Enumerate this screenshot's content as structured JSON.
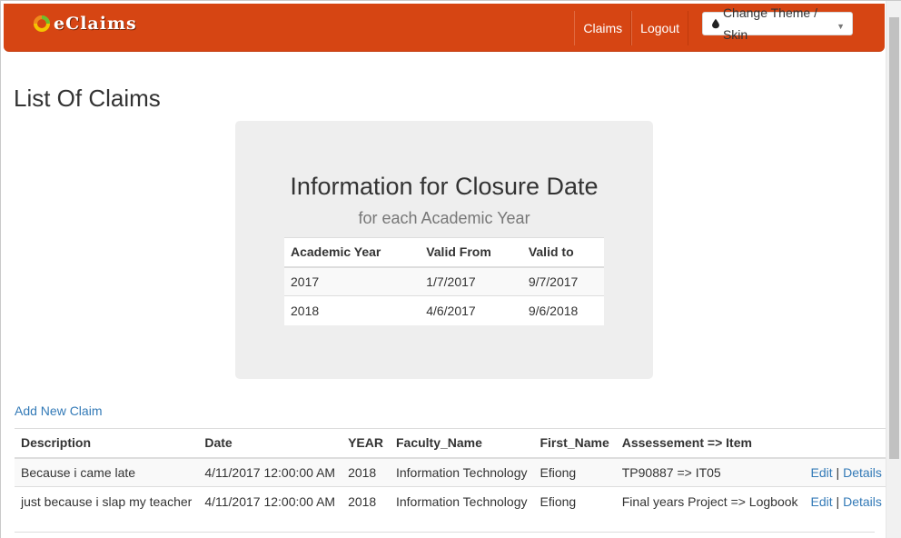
{
  "navbar": {
    "brand": "eClaims",
    "links": [
      "Claims",
      "Logout"
    ],
    "theme_button": "Change Theme / Skin",
    "colors": {
      "background": "#d64513",
      "text": "#ffffff"
    }
  },
  "page_title": "List Of Claims",
  "closure_info": {
    "title": "Information for Closure Date",
    "subtitle": "for each Academic Year",
    "headers": [
      "Academic Year",
      "Valid From",
      "Valid to"
    ],
    "rows": [
      [
        "2017",
        "1/7/2017",
        "9/7/2017"
      ],
      [
        "2018",
        "4/6/2017",
        "9/6/2018"
      ]
    ]
  },
  "add_claim_label": "Add New Claim",
  "claims": {
    "headers": [
      "Description",
      "Date",
      "YEAR",
      "Faculty_Name",
      "First_Name",
      "Assessement => Item",
      ""
    ],
    "rows": [
      {
        "description": "Because i came late",
        "date": "4/11/2017 12:00:00 AM",
        "year": "2018",
        "faculty": "Information Technology",
        "first_name": "Efiong",
        "assessment": "TP90887 => IT05",
        "edit": "Edit",
        "details": "Details"
      },
      {
        "description": "just because i slap my teacher",
        "date": "4/11/2017 12:00:00 AM",
        "year": "2018",
        "faculty": "Information Technology",
        "first_name": "Efiong",
        "assessment": "Final years Project => Logbook",
        "edit": "Edit",
        "details": "Details"
      }
    ]
  },
  "icons": {
    "brand_logo": "ring-logo-icon",
    "theme": "drop-icon",
    "caret": "caret-down-icon"
  },
  "colors": {
    "link": "#337ab7",
    "panel": "#eeeeee"
  }
}
